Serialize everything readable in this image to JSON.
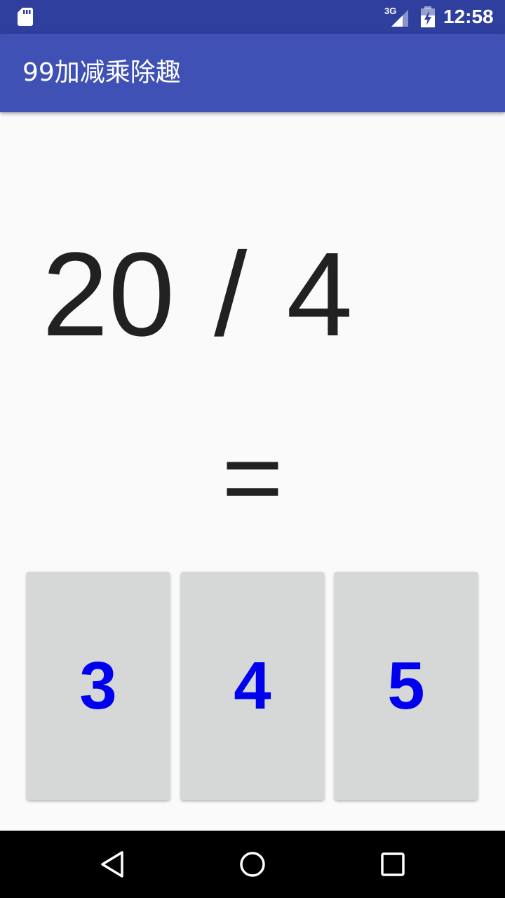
{
  "status_bar": {
    "network": "3G",
    "time": "12:58",
    "icons": [
      "sd-card-icon",
      "signal-icon",
      "battery-charging-icon"
    ]
  },
  "app_bar": {
    "title": "99加减乘除趣"
  },
  "question": {
    "left_operand": "20",
    "operator": "/",
    "right_operand": "4"
  },
  "equals": "=",
  "answers": [
    "3",
    "4",
    "5"
  ],
  "colors": {
    "status_bar": "#2f3f9e",
    "app_bar": "#3f51b5",
    "answer_text": "#0000ee",
    "answer_button": "#d6d7d7",
    "question_text": "#212121"
  },
  "nav_bar": {
    "icons": [
      "back-icon",
      "home-icon",
      "recents-icon"
    ]
  }
}
